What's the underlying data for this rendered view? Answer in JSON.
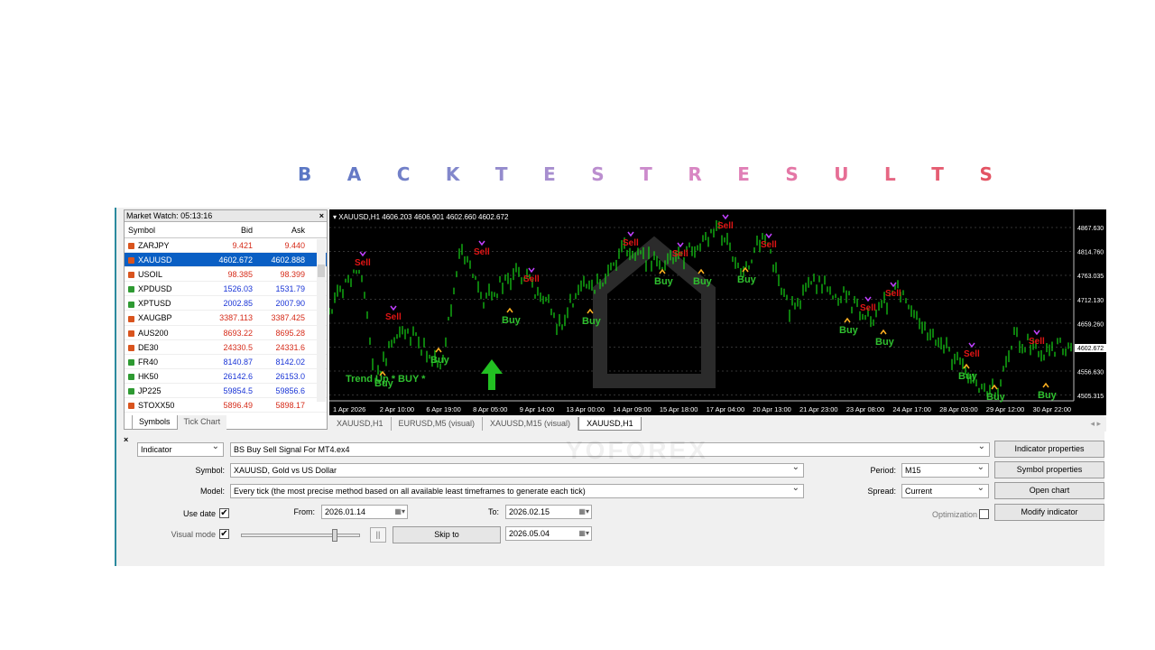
{
  "heading": {
    "letters": [
      {
        "ch": "B",
        "color": "#5b77c4"
      },
      {
        "ch": "A",
        "color": "#667ac6"
      },
      {
        "ch": "C",
        "color": "#7280c8"
      },
      {
        "ch": "K",
        "color": "#8287cb"
      },
      {
        "ch": "T",
        "color": "#948bcd"
      },
      {
        "ch": "E",
        "color": "#a78ecf"
      },
      {
        "ch": "S",
        "color": "#bb8ecf"
      },
      {
        "ch": "T",
        "color": "#cc8bcc"
      },
      {
        "ch": "R",
        "color": "#d886c3"
      },
      {
        "ch": "E",
        "color": "#e07fb6"
      },
      {
        "ch": "S",
        "color": "#e477a6"
      },
      {
        "ch": "U",
        "color": "#e66e95"
      },
      {
        "ch": "L",
        "color": "#e66683"
      },
      {
        "ch": "T",
        "color": "#e55d72"
      },
      {
        "ch": "S",
        "color": "#e35363"
      }
    ]
  },
  "market_watch": {
    "title": "Market Watch: 05:13:16",
    "close": "×",
    "headers": {
      "symbol": "Symbol",
      "bid": "Bid",
      "ask": "Ask"
    },
    "rows": [
      {
        "symbol": "ZARJPY",
        "bid": "9.421",
        "ask": "9.440",
        "color": "#d62c1a",
        "icon": "#d9541e"
      },
      {
        "symbol": "XAUUSD",
        "bid": "4602.672",
        "ask": "4602.888",
        "color": "#ffffff",
        "icon": "#d9541e",
        "selected": true
      },
      {
        "symbol": "USOIL",
        "bid": "98.385",
        "ask": "98.399",
        "color": "#d62c1a",
        "icon": "#d9541e"
      },
      {
        "symbol": "XPDUSD",
        "bid": "1526.03",
        "ask": "1531.79",
        "color": "#1a35d6",
        "icon": "#2e9a32"
      },
      {
        "symbol": "XPTUSD",
        "bid": "2002.85",
        "ask": "2007.90",
        "color": "#1a35d6",
        "icon": "#2e9a32"
      },
      {
        "symbol": "XAUGBP",
        "bid": "3387.113",
        "ask": "3387.425",
        "color": "#d62c1a",
        "icon": "#d9541e"
      },
      {
        "symbol": "AUS200",
        "bid": "8693.22",
        "ask": "8695.28",
        "color": "#d62c1a",
        "icon": "#d9541e"
      },
      {
        "symbol": "DE30",
        "bid": "24330.5",
        "ask": "24331.6",
        "color": "#d62c1a",
        "icon": "#d9541e"
      },
      {
        "symbol": "FR40",
        "bid": "8140.87",
        "ask": "8142.02",
        "color": "#1a35d6",
        "icon": "#2e9a32"
      },
      {
        "symbol": "HK50",
        "bid": "26142.6",
        "ask": "26153.0",
        "color": "#1a35d6",
        "icon": "#2e9a32"
      },
      {
        "symbol": "JP225",
        "bid": "59854.5",
        "ask": "59856.6",
        "color": "#1a35d6",
        "icon": "#2e9a32"
      },
      {
        "symbol": "STOXX50",
        "bid": "5896.49",
        "ask": "5898.17",
        "color": "#d62c1a",
        "icon": "#d9541e"
      }
    ],
    "tabs": [
      "Symbols",
      "Tick Chart"
    ]
  },
  "chart": {
    "header": "▾ XAUUSD,H1  4606.203 4606.901 4602.660 4602.672",
    "price_labels": [
      "4867.630",
      "4814.760",
      "4763.035",
      "4712.130",
      "4659.260",
      "4602.672",
      "4556.630",
      "4505.315"
    ],
    "current_price": "4602.672",
    "time_labels": [
      "1 Apr 2026",
      "2 Apr 10:00",
      "6 Apr 19:00",
      "8 Apr 05:00",
      "9 Apr 14:00",
      "13 Apr 00:00",
      "14 Apr 09:00",
      "15 Apr 18:00",
      "17 Apr 04:00",
      "20 Apr 13:00",
      "21 Apr 23:00",
      "23 Apr 08:00",
      "24 Apr 17:00",
      "28 Apr 03:00",
      "29 Apr 12:00",
      "30 Apr 22:00"
    ],
    "sell_label": "Sell",
    "buy_label": "Buy",
    "trend_label": "Trend Up * BUY *",
    "sell_color": "#e01515",
    "buy_color": "#2fc02f",
    "line_color": "#16d216"
  },
  "chart_tabs": [
    "XAUUSD,H1",
    "EURUSD,M5 (visual)",
    "XAUUSD,M15 (visual)",
    "XAUUSD,H1"
  ],
  "tab_arrows": "◂ ▸",
  "tester": {
    "close": "×",
    "type_value": "Indicator",
    "expert_value": "BS Buy Sell Signal For MT4.ex4",
    "symbol_label": "Symbol:",
    "symbol_value": "XAUUSD, Gold vs US Dollar",
    "model_label": "Model:",
    "model_value": "Every tick (the most precise method based on all available least timeframes to generate each tick)",
    "use_date_label": "Use date",
    "from_label": "From:",
    "from_value": "2026.01.14",
    "to_label": "To:",
    "to_value": "2026.02.15",
    "visual_label": "Visual mode",
    "skip_label": "Skip to",
    "skip_value": "2026.05.04",
    "period_label": "Period:",
    "period_value": "M15",
    "spread_label": "Spread:",
    "spread_value": "Current",
    "optimization_label": "Optimization",
    "btn_indicator_props": "Indicator properties",
    "btn_symbol_props": "Symbol properties",
    "btn_open_chart": "Open chart",
    "btn_modify": "Modify indicator",
    "check_mark": "✔",
    "pause_glyph": "||",
    "cal_glyph": "▦▾"
  },
  "watermark": "YOFOREX"
}
